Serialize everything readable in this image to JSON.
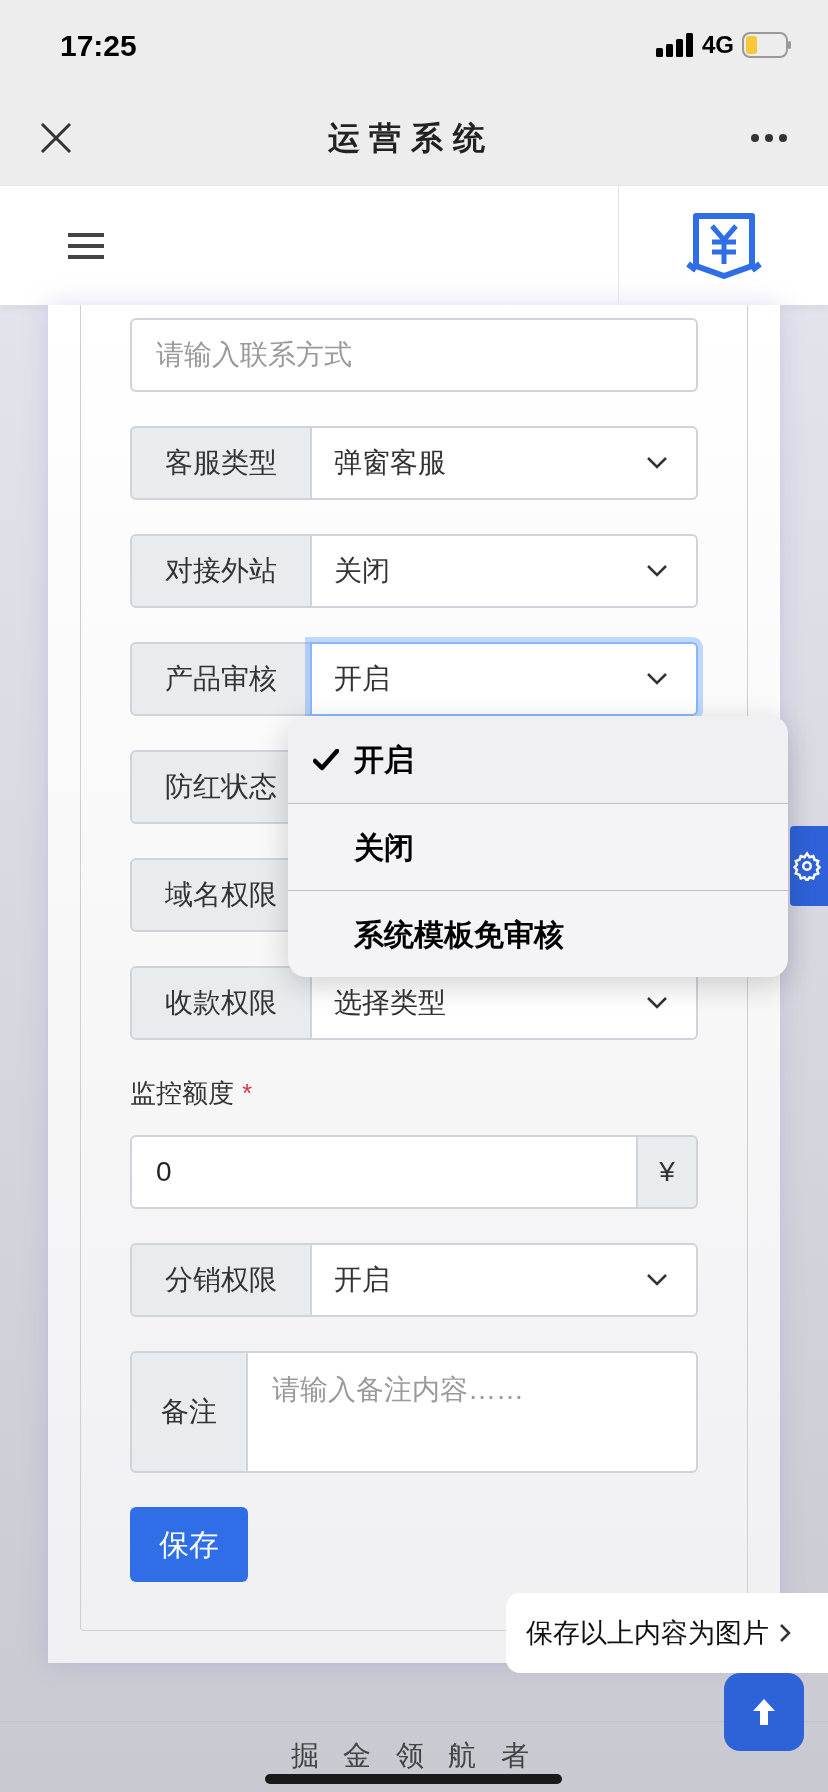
{
  "status_bar": {
    "time": "17:25",
    "network": "4G"
  },
  "nav": {
    "title": "运营系统"
  },
  "form": {
    "fields": [
      {
        "kind": "input",
        "placeholder": "请输入联系方式"
      },
      {
        "kind": "select",
        "label": "客服类型",
        "value": "弹窗客服",
        "focused": false
      },
      {
        "kind": "select",
        "label": "对接外站",
        "value": "关闭",
        "focused": false
      },
      {
        "kind": "select",
        "label": "产品审核",
        "value": "开启",
        "focused": true
      },
      {
        "kind": "select",
        "label": "防红状态"
      },
      {
        "kind": "select",
        "label": "域名权限"
      },
      {
        "kind": "select",
        "label": "收款权限",
        "value": "选择类型",
        "focused": false
      },
      {
        "kind": "amount",
        "label": "监控额度",
        "required_mark": "*",
        "value": "0",
        "suffix": "¥"
      },
      {
        "kind": "select",
        "label": "分销权限",
        "value": "开启",
        "focused": false
      },
      {
        "kind": "textarea",
        "label": "备注",
        "placeholder": "请输入备注内容……"
      }
    ],
    "submit": "保存"
  },
  "dropdown": {
    "options": [
      {
        "label": "开启",
        "selected": true
      },
      {
        "label": "关闭",
        "selected": false
      },
      {
        "label": "系统模板免审核",
        "selected": false
      }
    ]
  },
  "save_image_prompt": "保存以上内容为图片",
  "footer": "掘 金 领 航 者"
}
